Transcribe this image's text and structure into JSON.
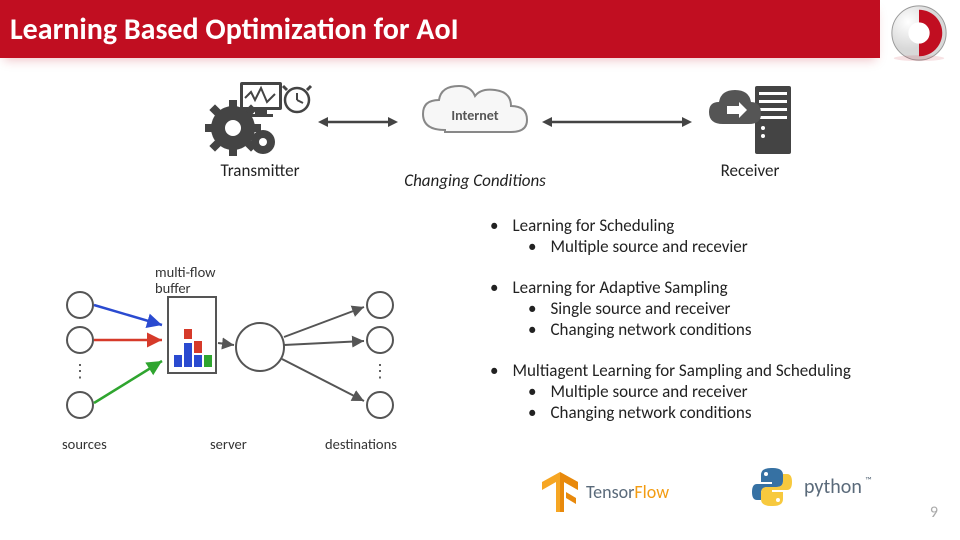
{
  "title": "Learning Based Optimization for AoI",
  "arch": {
    "transmitter": "Transmitter",
    "internet": "Internet",
    "changing": "Changing Conditions",
    "receiver": "Receiver"
  },
  "bullets": [
    {
      "text": "Learning for Scheduling",
      "sub": [
        "Multiple source and recevier"
      ]
    },
    {
      "text": "Learning for Adaptive Sampling",
      "sub": [
        "Single source and receiver",
        "Changing network conditions"
      ]
    },
    {
      "text": "Multiagent Learning for Sampling and Scheduling",
      "sub": [
        "Multiple source and receiver",
        "Changing network conditions"
      ]
    }
  ],
  "mf": {
    "buffer": "multi-flow\nbuffer",
    "sources": "sources",
    "server": "server",
    "destinations": "destinations"
  },
  "logos": {
    "tf1": "Tensor",
    "tf2": "Flow",
    "py": "python",
    "py_tm": "™"
  },
  "page": "9"
}
